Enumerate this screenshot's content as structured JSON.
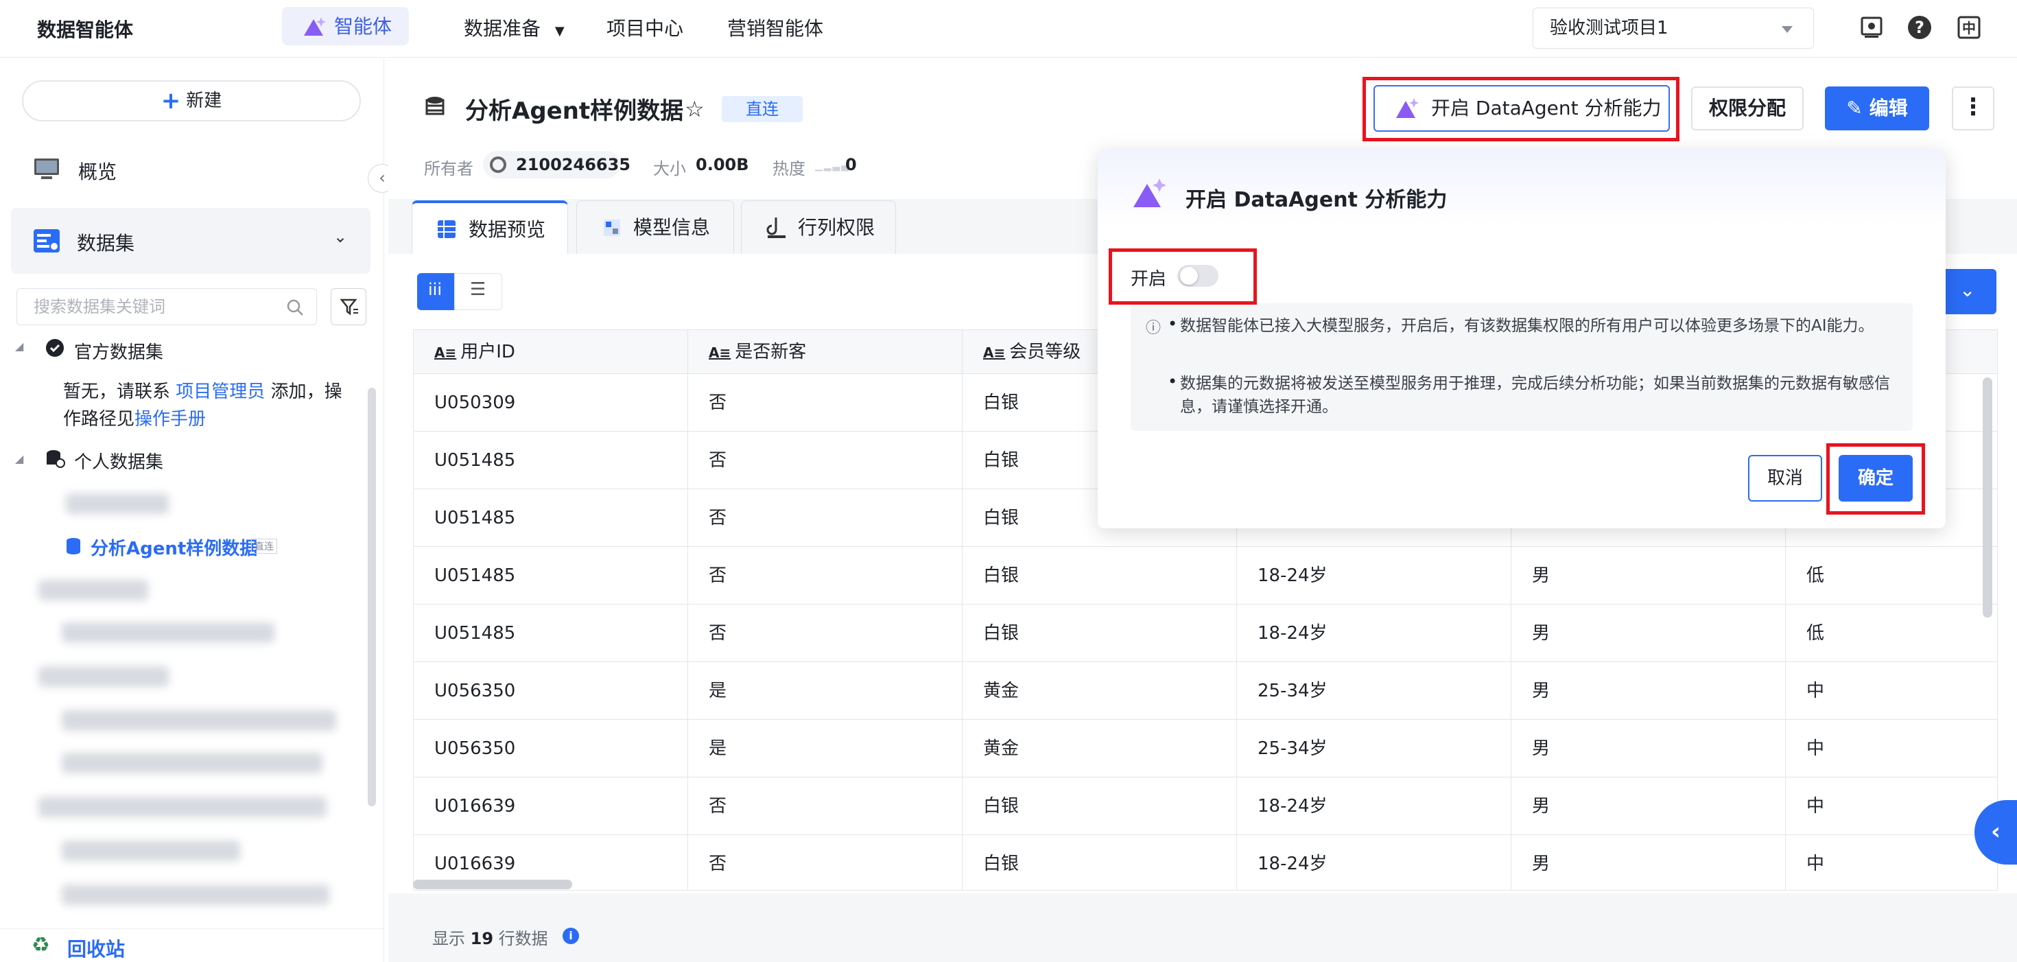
{
  "topbar": {
    "brand": "数据智能体",
    "nav": {
      "agent": "智能体",
      "data_prep": "数据准备",
      "project_center": "项目中心",
      "marketing_agent": "营销智能体"
    },
    "project_select": "验收测试项目1"
  },
  "sidebar": {
    "new_label": "新建",
    "overview": "概览",
    "datasets": "数据集",
    "search_placeholder": "搜索数据集关键词",
    "official": "官方数据集",
    "official_note_1": "暂无，请联系",
    "official_note_link": "项目管理员",
    "official_note_2": "添加，操",
    "official_note_3": "作路径见",
    "official_note_link2": "操作手册",
    "personal": "个人数据集",
    "active_dataset": "分析Agent样例数据",
    "active_badge": "直连",
    "recycle": "回收站"
  },
  "header": {
    "title": "分析Agent样例数据",
    "badge": "直连",
    "owner_label": "所有者",
    "owner_value": "2100246635",
    "size_label": "大小",
    "size_value": "0.00B",
    "heat_label": "热度",
    "heat_value": "0",
    "agent_btn": "开启 DataAgent 分析能力",
    "perm_btn": "权限分配",
    "edit_btn": "编辑"
  },
  "tabs": {
    "preview": "数据预览",
    "model": "模型信息",
    "rowcol": "行列权限"
  },
  "table": {
    "headers": [
      "用户ID",
      "是否新客",
      "会员等级"
    ],
    "rows": [
      [
        "U050309",
        "否",
        "白银",
        "",
        "",
        ""
      ],
      [
        "U051485",
        "否",
        "白银",
        "",
        "",
        ""
      ],
      [
        "U051485",
        "否",
        "白银",
        "",
        "",
        ""
      ],
      [
        "U051485",
        "否",
        "白银",
        "18-24岁",
        "男",
        "低"
      ],
      [
        "U051485",
        "否",
        "白银",
        "18-24岁",
        "男",
        "低"
      ],
      [
        "U056350",
        "是",
        "黄金",
        "25-34岁",
        "男",
        "中"
      ],
      [
        "U056350",
        "是",
        "黄金",
        "25-34岁",
        "男",
        "中"
      ],
      [
        "U016639",
        "否",
        "白银",
        "18-24岁",
        "男",
        "中"
      ],
      [
        "U016639",
        "否",
        "白银",
        "18-24岁",
        "男",
        "中"
      ]
    ],
    "footer_prefix": "显示",
    "footer_count": "19",
    "footer_suffix": "行数据"
  },
  "modal": {
    "title": "开启 DataAgent 分析能力",
    "toggle_label": "开启",
    "notice_1": "数据智能体已接入大模型服务，开启后，有该数据集权限的所有用户可以体验更多场景下的AI能力。",
    "notice_2": "数据集的元数据将被发送至模型服务用于推理，完成后续分析功能；如果当前数据集的元数据有敏感信息，请谨慎选择开通。",
    "cancel": "取消",
    "ok": "确定"
  },
  "colors": {
    "accent": "#2b6cf6",
    "highlight": "#e8131f"
  }
}
